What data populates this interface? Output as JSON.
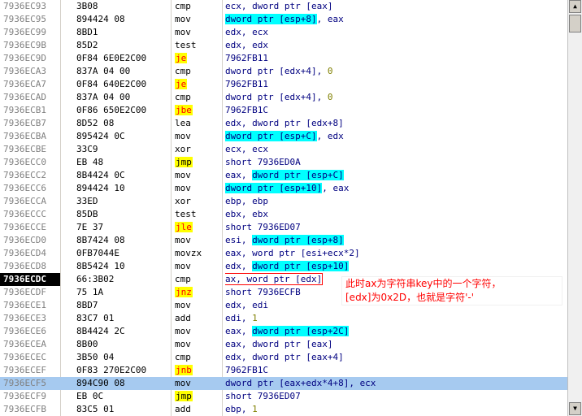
{
  "colors": {
    "selected_row": "#a6caf0",
    "current_eip": "#000000",
    "jump_highlight": "#ffff00",
    "memory_highlight": "#00ffff",
    "annotation": "#ff0000"
  },
  "rows": [
    {
      "addr": "7936EC93",
      "hex": "3B08",
      "mn": "cmp",
      "ops": [
        {
          "t": "ecx, dword ptr [eax]"
        }
      ]
    },
    {
      "addr": "7936EC95",
      "hex": "894424 08",
      "mn": "mov",
      "ops": [
        {
          "t": "dword ptr [esp+8]",
          "k": "mem"
        },
        {
          "t": ", eax"
        }
      ]
    },
    {
      "addr": "7936EC99",
      "hex": "8BD1",
      "mn": "mov",
      "ops": [
        {
          "t": "edx, ecx"
        }
      ]
    },
    {
      "addr": "7936EC9B",
      "hex": "85D2",
      "mn": "test",
      "ops": [
        {
          "t": "edx, edx"
        }
      ]
    },
    {
      "addr": "7936EC9D",
      "hex": "0F84 6E0E2C00",
      "mn": "je",
      "mk": "jr",
      "ops": [
        {
          "t": "7962FB11"
        }
      ]
    },
    {
      "addr": "7936ECA3",
      "hex": "837A 04 00",
      "mn": "cmp",
      "ops": [
        {
          "t": "dword ptr [edx+4], "
        },
        {
          "t": "0",
          "k": "num"
        }
      ]
    },
    {
      "addr": "7936ECA7",
      "hex": "0F84 640E2C00",
      "mn": "je",
      "mk": "jr",
      "ops": [
        {
          "t": "7962FB11"
        }
      ]
    },
    {
      "addr": "7936ECAD",
      "hex": "837A 04 00",
      "mn": "cmp",
      "ops": [
        {
          "t": "dword ptr [edx+4], "
        },
        {
          "t": "0",
          "k": "num"
        }
      ]
    },
    {
      "addr": "7936ECB1",
      "hex": "0F86 650E2C00",
      "mn": "jbe",
      "mk": "jr",
      "ops": [
        {
          "t": "7962FB1C"
        }
      ]
    },
    {
      "addr": "7936ECB7",
      "hex": "8D52 08",
      "mn": "lea",
      "ops": [
        {
          "t": "edx, dword ptr [edx+8]"
        }
      ]
    },
    {
      "addr": "7936ECBA",
      "hex": "895424 0C",
      "mn": "mov",
      "ops": [
        {
          "t": "dword ptr [esp+C]",
          "k": "mem"
        },
        {
          "t": ", edx"
        }
      ]
    },
    {
      "addr": "7936ECBE",
      "hex": "33C9",
      "mn": "xor",
      "ops": [
        {
          "t": "ecx, ecx"
        }
      ]
    },
    {
      "addr": "7936ECC0",
      "hex": "EB 48",
      "mn": "jmp",
      "mk": "jy",
      "ops": [
        {
          "t": "short 7936ED0A"
        }
      ]
    },
    {
      "addr": "7936ECC2",
      "hex": "8B4424 0C",
      "mn": "mov",
      "ops": [
        {
          "t": "eax, "
        },
        {
          "t": "dword ptr [esp+C]",
          "k": "mem"
        }
      ]
    },
    {
      "addr": "7936ECC6",
      "hex": "894424 10",
      "mn": "mov",
      "ops": [
        {
          "t": "dword ptr [esp+10]",
          "k": "mem"
        },
        {
          "t": ", eax"
        }
      ]
    },
    {
      "addr": "7936ECCA",
      "hex": "33ED",
      "mn": "xor",
      "ops": [
        {
          "t": "ebp, ebp"
        }
      ]
    },
    {
      "addr": "7936ECCC",
      "hex": "85DB",
      "mn": "test",
      "ops": [
        {
          "t": "ebx, ebx"
        }
      ]
    },
    {
      "addr": "7936ECCE",
      "hex": "7E 37",
      "mn": "jle",
      "mk": "jr",
      "ops": [
        {
          "t": "short 7936ED07"
        }
      ]
    },
    {
      "addr": "7936ECD0",
      "hex": "8B7424 08",
      "mn": "mov",
      "ops": [
        {
          "t": "esi, "
        },
        {
          "t": "dword ptr [esp+8]",
          "k": "mem"
        }
      ]
    },
    {
      "addr": "7936ECD4",
      "hex": "0FB7044E",
      "mn": "movzx",
      "ops": [
        {
          "t": "eax, word ptr [esi+ecx*2]"
        }
      ]
    },
    {
      "addr": "7936ECD8",
      "hex": "8B5424 10",
      "mn": "mov",
      "ops": [
        {
          "t": "edx, "
        },
        {
          "t": "dword ptr [esp+10]",
          "k": "mem"
        }
      ]
    },
    {
      "addr": "7936ECDC",
      "hex": "66:3B02",
      "mn": "cmp",
      "cur": true,
      "boxed": true,
      "ops": [
        {
          "t": "ax, word ptr [edx]"
        }
      ]
    },
    {
      "addr": "7936ECDF",
      "hex": "75 1A",
      "mn": "jnz",
      "mk": "jr",
      "ops": [
        {
          "t": "short 7936ECFB"
        }
      ]
    },
    {
      "addr": "7936ECE1",
      "hex": "8BD7",
      "mn": "mov",
      "ops": [
        {
          "t": "edx, edi"
        }
      ]
    },
    {
      "addr": "7936ECE3",
      "hex": "83C7 01",
      "mn": "add",
      "ops": [
        {
          "t": "edi, "
        },
        {
          "t": "1",
          "k": "num"
        }
      ]
    },
    {
      "addr": "7936ECE6",
      "hex": "8B4424 2C",
      "mn": "mov",
      "ops": [
        {
          "t": "eax, "
        },
        {
          "t": "dword ptr [esp+2C]",
          "k": "mem"
        }
      ]
    },
    {
      "addr": "7936ECEA",
      "hex": "8B00",
      "mn": "mov",
      "ops": [
        {
          "t": "eax, dword ptr [eax]"
        }
      ]
    },
    {
      "addr": "7936ECEC",
      "hex": "3B50 04",
      "mn": "cmp",
      "ops": [
        {
          "t": "edx, dword ptr [eax+4]"
        }
      ]
    },
    {
      "addr": "7936ECEF",
      "hex": "0F83 270E2C00",
      "mn": "jnb",
      "mk": "jr",
      "ops": [
        {
          "t": "7962FB1C"
        }
      ]
    },
    {
      "addr": "7936ECF5",
      "hex": "894C90 08",
      "mn": "mov",
      "sel": true,
      "ops": [
        {
          "t": "dword ptr [eax+edx*4+8], ecx"
        }
      ]
    },
    {
      "addr": "7936ECF9",
      "hex": "EB 0C",
      "mn": "jmp",
      "mk": "jy",
      "ops": [
        {
          "t": "short 7936ED07"
        }
      ]
    },
    {
      "addr": "7936ECFB",
      "hex": "83C5 01",
      "mn": "add",
      "ops": [
        {
          "t": "ebp, "
        },
        {
          "t": "1",
          "k": "num"
        }
      ]
    }
  ],
  "annotation": {
    "line1": "此时ax为字符串key中的一个字符，",
    "line2": "[edx]为0x2D，也就是字符'-'"
  },
  "scrollbar": {
    "up_glyph": "▲",
    "down_glyph": "▼"
  }
}
